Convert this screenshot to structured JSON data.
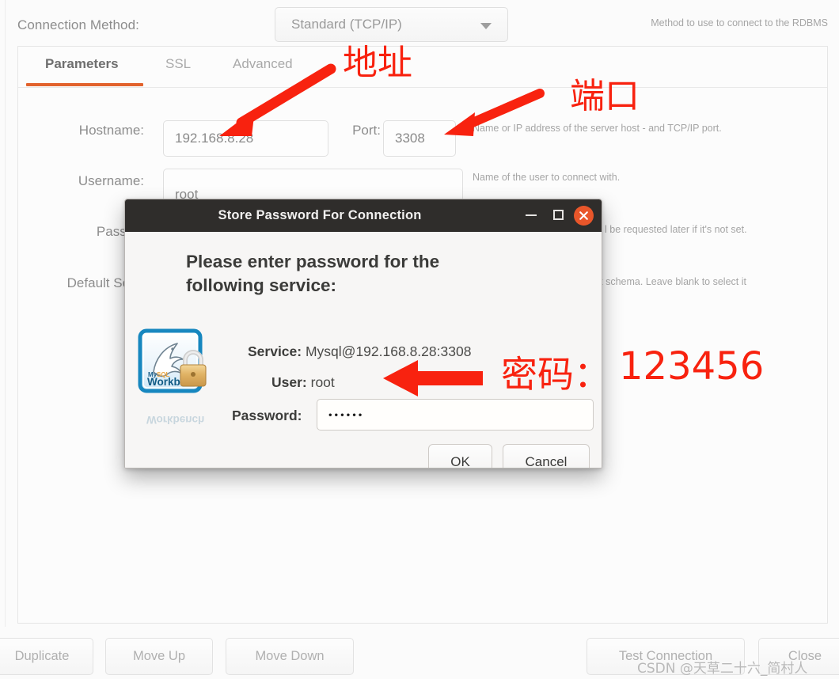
{
  "background": {
    "connection_method": {
      "label": "Connection Method:",
      "value": "Standard (TCP/IP)",
      "hint": "Method to use to connect to the RDBMS"
    },
    "tabs": [
      {
        "label": "Parameters",
        "active": true
      },
      {
        "label": "SSL",
        "active": false
      },
      {
        "label": "Advanced",
        "active": false
      }
    ],
    "fields": {
      "hostname_label": "Hostname:",
      "hostname_value": "192.168.8.28",
      "port_label": "Port:",
      "port_value": "3308",
      "hostport_hint": "Name or IP address of the server host - and TCP/IP port.",
      "username_label": "Username:",
      "username_value": "root",
      "username_hint": "Name of the user to connect with.",
      "password_label": "Passw",
      "password_hint": "l be requested later if it's not set.",
      "schema_label": "Default Sche",
      "schema_hint": "fault schema. Leave blank to select it"
    },
    "buttons": [
      {
        "label": "Duplicate"
      },
      {
        "label": "Move Up"
      },
      {
        "label": "Move Down"
      },
      {
        "label": "Test Connection"
      },
      {
        "label": "Close"
      }
    ]
  },
  "dialog": {
    "title": "Store Password For Connection",
    "titlebar_icons": {
      "minimize": "minimize-icon",
      "maximize": "maximize-icon",
      "close": "close-icon"
    },
    "heading": "Please enter password for the following service:",
    "logo_alt": "mysql-workbench-logo",
    "service_label": "Service:",
    "service_value": "Mysql@192.168.8.28:3308",
    "user_label": "User:",
    "user_value": "root",
    "password_label": "Password:",
    "password_masked": "••••••",
    "ok_label": "OK",
    "cancel_label": "Cancel"
  },
  "annotations": {
    "address": "地址",
    "port": "端口",
    "password": "密码：",
    "password_value": "123456",
    "color": "#f8220f"
  },
  "watermark": "CSDN @天草二十六_简村人",
  "colors": {
    "accent": "#e2622c",
    "titlebar": "#2f2d2b",
    "close_button": "#e9562a",
    "annotation_red": "#f8220f"
  }
}
